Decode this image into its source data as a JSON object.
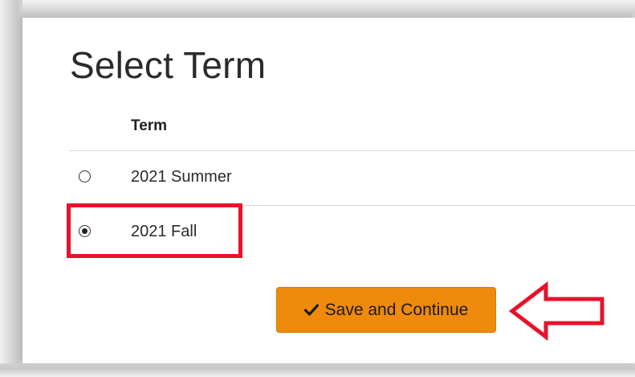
{
  "page": {
    "title": "Select Term"
  },
  "table": {
    "column_header": "Term",
    "rows": [
      {
        "label": "2021 Summer",
        "selected": false
      },
      {
        "label": "2021 Fall",
        "selected": true
      }
    ]
  },
  "actions": {
    "save_label": "Save and Continue",
    "save_icon": "check-icon"
  },
  "colors": {
    "button_background": "#ee8a0c",
    "annotation_red": "#e8122b"
  }
}
